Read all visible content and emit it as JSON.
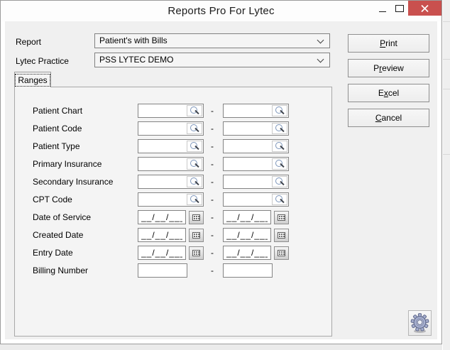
{
  "window": {
    "title": "Reports Pro For Lytec",
    "icons": {
      "minimize": "minimize-dash",
      "maximize": "maximize-square",
      "close": "close-x",
      "dropdown": "chevron-down",
      "lookup": "magnifier",
      "calendar": "calendar-grid",
      "settings": "gear"
    }
  },
  "selectors": {
    "report": {
      "label": "Report",
      "value": "Patient's with Bills"
    },
    "practice": {
      "label": "Lytec Practice",
      "value": "PSS LYTEC DEMO"
    }
  },
  "tabs": [
    {
      "label": "Ranges",
      "active": true
    }
  ],
  "actions": [
    {
      "name": "print",
      "pre": "",
      "key": "P",
      "post": "rint"
    },
    {
      "name": "preview",
      "pre": "P",
      "key": "r",
      "post": "eview"
    },
    {
      "name": "excel",
      "pre": "E",
      "key": "x",
      "post": "cel"
    },
    {
      "name": "cancel",
      "pre": "",
      "key": "C",
      "post": "ancel"
    }
  ],
  "range_separator": "-",
  "range_rows": [
    {
      "label": "Patient Chart",
      "type": "lookup",
      "from": "",
      "to": ""
    },
    {
      "label": "Patient Code",
      "type": "lookup",
      "from": "",
      "to": ""
    },
    {
      "label": "Patient Type",
      "type": "lookup",
      "from": "",
      "to": ""
    },
    {
      "label": "Primary Insurance",
      "type": "lookup",
      "from": "",
      "to": ""
    },
    {
      "label": "Secondary Insurance",
      "type": "lookup",
      "from": "",
      "to": ""
    },
    {
      "label": "CPT Code",
      "type": "lookup",
      "from": "",
      "to": ""
    },
    {
      "label": "Date of Service",
      "type": "date",
      "mask": "__/__/____"
    },
    {
      "label": "Created Date",
      "type": "date",
      "mask": "__/__/____"
    },
    {
      "label": "Entry Date",
      "type": "date",
      "mask": "__/__/____"
    },
    {
      "label": "Billing Number",
      "type": "plain",
      "from": "",
      "to": ""
    }
  ],
  "colors": {
    "close_button": "#c9504e",
    "titlebar_bg": "#fdfdfd",
    "client_bg": "#f0f0f0",
    "panel_bg": "#f4f4f4",
    "magnifier_blue": "#7d96bb"
  }
}
